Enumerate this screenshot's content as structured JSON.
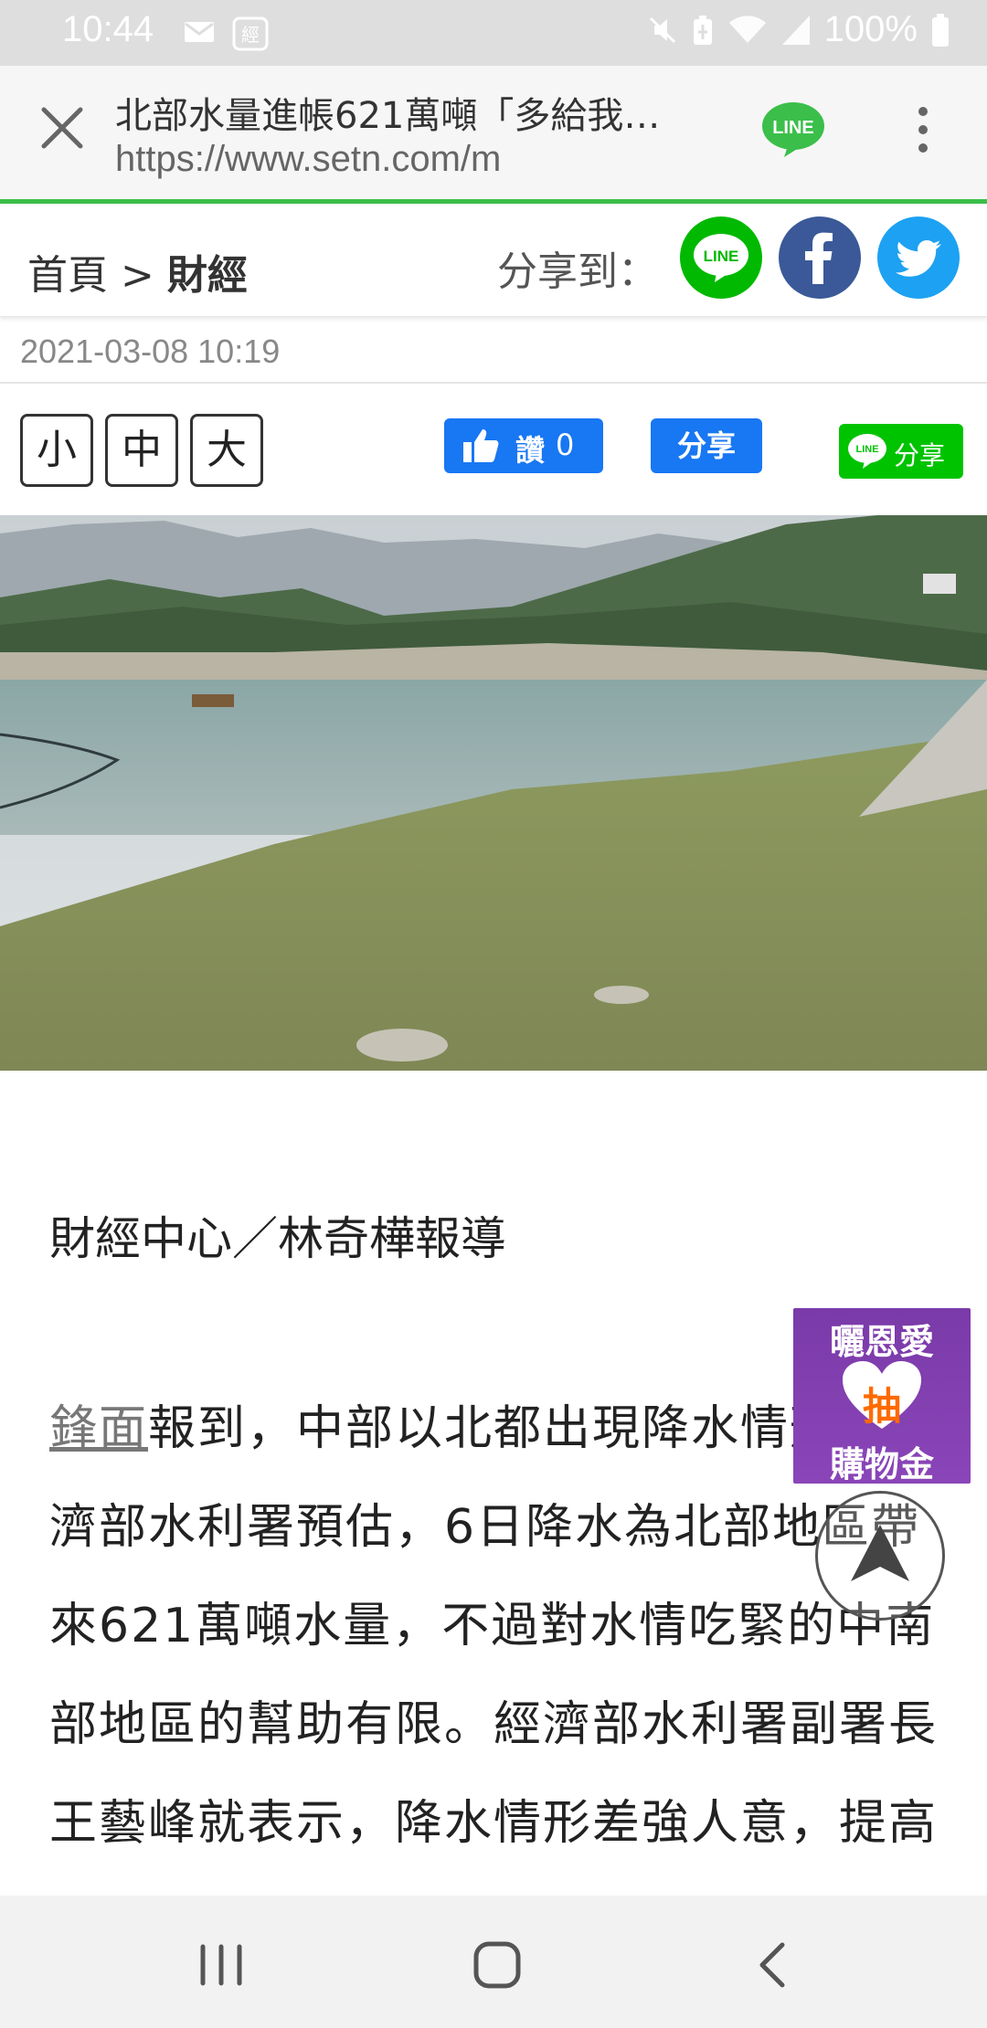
{
  "status_bar": {
    "time": "10:44",
    "battery": "100%",
    "icons": [
      "mail-icon",
      "app-notification-icon",
      "mute-icon",
      "battery-saver-icon",
      "wifi-icon",
      "signal-icon",
      "battery-icon"
    ]
  },
  "browser": {
    "page_title": "北部水量進帳621萬噸「多給我…",
    "url": "https://www.setn.com/m",
    "toolbar_icons": [
      "close-icon",
      "line-icon",
      "more-icon"
    ]
  },
  "header": {
    "breadcrumb_home": "首頁",
    "breadcrumb_separator": " > ",
    "breadcrumb_current": "財經",
    "share_label": "分享到：",
    "share_line_text": "LINE"
  },
  "article": {
    "date": "2021-03-08 10:19",
    "font_sizes": [
      "小",
      "中",
      "大"
    ],
    "fb_like_label": "讚",
    "fb_like_count": "0",
    "fb_share_label": "分享",
    "line_share_label": "分享",
    "byline": "財經中心／林奇樺報導",
    "body_link": "鋒面",
    "body_text": "報到，中部以北都出現降水情形，經濟部水利署預估，6日降水為北部地區帶來621萬噸水量，不過對水情吃緊的中南部地區的幫助有限。經濟部水利署副署長王藝峰就表示，降水情形差強人意，提高中南部的局負短期難解。"
  },
  "ad": {
    "top": "曬恩愛",
    "middle": "抽",
    "bottom": "購物金"
  },
  "nav_bar": {
    "icons": [
      "recents-icon",
      "home-icon",
      "back-icon"
    ]
  },
  "colors": {
    "accent_green": "#3bbf4a",
    "facebook_blue": "#1877f2",
    "line_green": "#00c300",
    "ad_purple": "#7a3aa8"
  }
}
